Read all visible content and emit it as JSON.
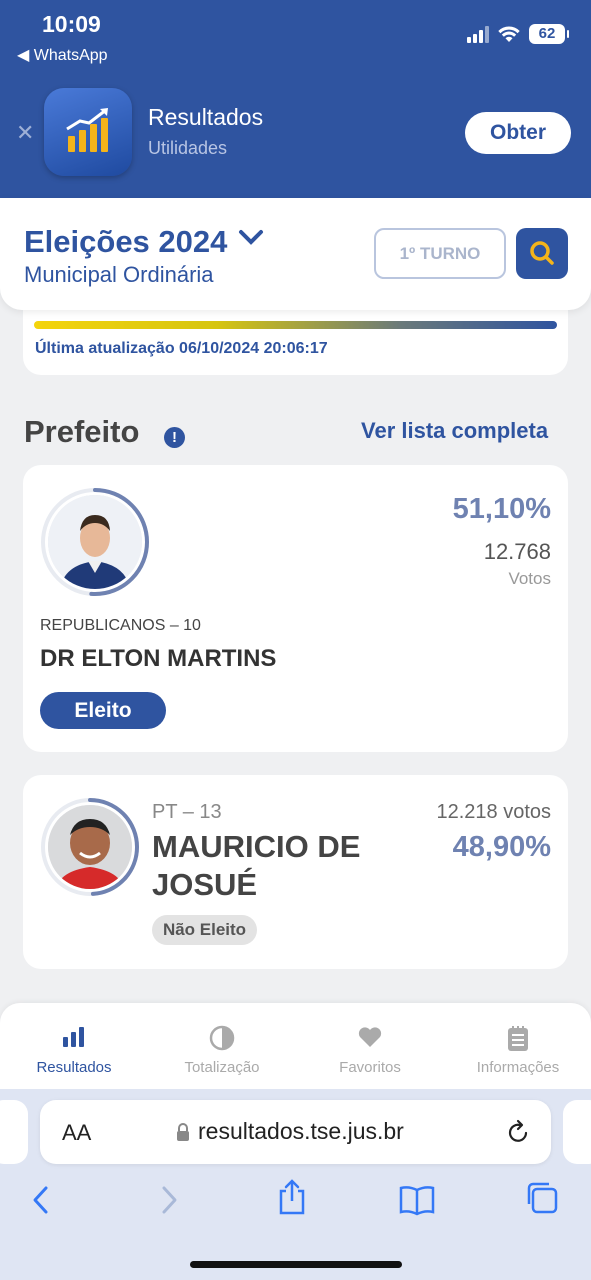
{
  "status_bar": {
    "time": "10:09",
    "back_app": "WhatsApp",
    "battery": "62"
  },
  "app_banner": {
    "name": "Resultados",
    "category": "Utilidades",
    "get_label": "Obter"
  },
  "header": {
    "title": "Eleições 2024",
    "subtitle": "Municipal Ordinária",
    "turno_label": "1º TURNO"
  },
  "progress": {
    "fill": 1.0,
    "last_update": "Última atualização 06/10/2024 20:06:17"
  },
  "section": {
    "title": "Prefeito",
    "info_icon": "!",
    "link_label": "Ver lista completa"
  },
  "candidates": [
    {
      "party": "REPUBLICANOS – 10",
      "name": "DR ELTON MARTINS",
      "percent": "51,10%",
      "votes": "12.768",
      "votes_label": "Votos",
      "status": "Eleito",
      "ring_fraction": 0.511
    },
    {
      "party": "PT – 13",
      "name_line1": "MAURICIO DE",
      "name_line2": "JOSUÉ",
      "percent": "48,90%",
      "votes": "12.218 votos",
      "status": "Não Eleito",
      "ring_fraction": 0.489
    }
  ],
  "tabs": [
    {
      "label": "Resultados",
      "icon": "bar-chart-icon",
      "active": true
    },
    {
      "label": "Totalização",
      "icon": "pie-chart-icon",
      "active": false
    },
    {
      "label": "Favoritos",
      "icon": "heart-icon",
      "active": false
    },
    {
      "label": "Informações",
      "icon": "notes-icon",
      "active": false
    }
  ],
  "browser": {
    "text_size_label": "AA",
    "url": "resultados.tse.jus.br"
  },
  "colors": {
    "primary": "#2f54a0",
    "percent": "#6f82b1",
    "accent_yellow": "#f4b41a"
  }
}
